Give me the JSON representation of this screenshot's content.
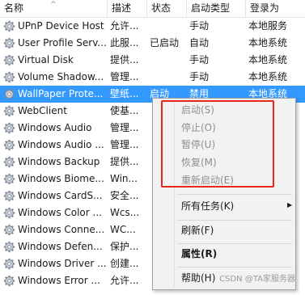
{
  "columns": {
    "name": "名称",
    "desc": "描述",
    "status": "状态",
    "startup": "启动类型",
    "logon": "登录为"
  },
  "services": [
    {
      "name": "UPnP Device Host",
      "desc": "允许...",
      "status": "",
      "startup": "手动",
      "logon": "本地服务"
    },
    {
      "name": "User Profile Serv...",
      "desc": "此服...",
      "status": "已启动",
      "startup": "自动",
      "logon": "本地系统"
    },
    {
      "name": "Virtual Disk",
      "desc": "提供...",
      "status": "",
      "startup": "手动",
      "logon": "本地系统"
    },
    {
      "name": "Volume Shadow...",
      "desc": "管理...",
      "status": "",
      "startup": "手动",
      "logon": "本地系统"
    },
    {
      "name": "WallPaper Prote...",
      "desc": "壁纸...",
      "status": "启动",
      "startup": "禁用",
      "logon": "本地系统"
    },
    {
      "name": "WebClient",
      "desc": "使基...",
      "status": "",
      "startup": "",
      "logon": "务"
    },
    {
      "name": "Windows Audio",
      "desc": "管理...",
      "status": "",
      "startup": "",
      "logon": "务"
    },
    {
      "name": "Windows Audio ...",
      "desc": "管理...",
      "status": "",
      "startup": "",
      "logon": "统"
    },
    {
      "name": "Windows Backup",
      "desc": "提供...",
      "status": "",
      "startup": "",
      "logon": "统"
    },
    {
      "name": "Windows Biome...",
      "desc": "Win...",
      "status": "",
      "startup": "",
      "logon": "统"
    },
    {
      "name": "Windows CardS...",
      "desc": "安全...",
      "status": "",
      "startup": "",
      "logon": "统"
    },
    {
      "name": "Windows Color ...",
      "desc": "Wcs...",
      "status": "",
      "startup": "",
      "logon": "务"
    },
    {
      "name": "Windows Conne...",
      "desc": "WC...",
      "status": "",
      "startup": "",
      "logon": "务"
    },
    {
      "name": "Windows Defen...",
      "desc": "保护...",
      "status": "",
      "startup": "",
      "logon": "统"
    },
    {
      "name": "Windows Driver ...",
      "desc": "创建...",
      "status": "",
      "startup": "",
      "logon": "统"
    },
    {
      "name": "Windows Error ...",
      "desc": "允许...",
      "status": "",
      "startup": "",
      "logon": "统"
    }
  ],
  "selected_index": 4,
  "context_menu": {
    "start": "启动(S)",
    "stop": "停止(O)",
    "pause": "暂停(U)",
    "resume": "恢复(M)",
    "restart": "重新启动(E)",
    "all_tasks": "所有任务(K)",
    "refresh": "刷新(F)",
    "properties": "属性(R)",
    "help": "帮助(H)"
  },
  "watermark": "CSDN @TA家服务器",
  "colors": {
    "selection": "#3399ff",
    "annotation_box": "#e8261c",
    "menu_bg": "#f2f2f2"
  }
}
